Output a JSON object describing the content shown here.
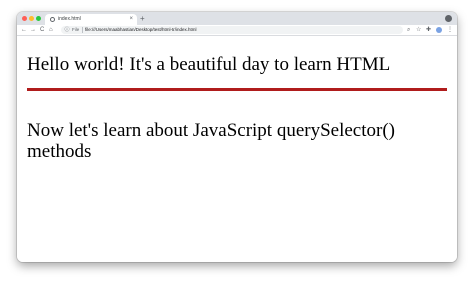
{
  "browser": {
    "tab_title": "index.html",
    "tab_close": "×",
    "new_tab": "+",
    "nav": {
      "back": "←",
      "forward": "→",
      "reload": "C",
      "home": "⌂"
    },
    "url_scheme": "File",
    "url": "file:///Users/maabhastian/Desktop/test/html-tr/index.html"
  },
  "page": {
    "heading": "Hello world! It's a beautiful day to learn HTML",
    "rule_color": "#b01c1c",
    "subheading": "Now let's learn about JavaScript querySelector() methods"
  }
}
